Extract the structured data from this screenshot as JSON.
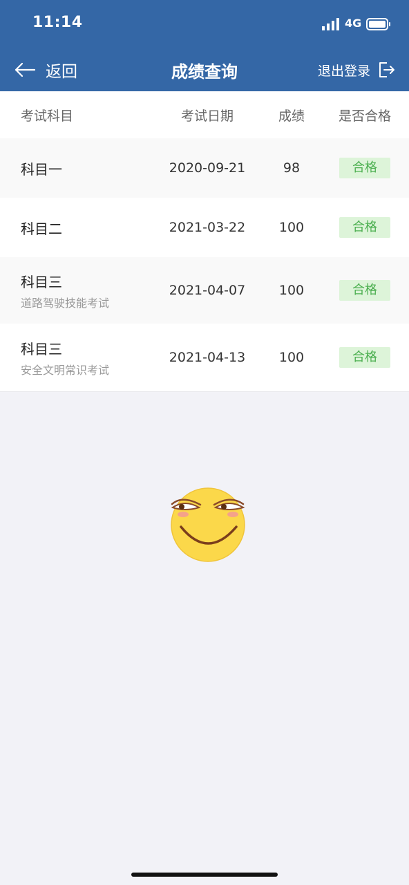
{
  "status_bar": {
    "time": "11:14",
    "network": "4G"
  },
  "nav": {
    "back_label": "返回",
    "title": "成绩查询",
    "logout_label": "退出登录"
  },
  "table": {
    "headers": {
      "subject": "考试科目",
      "date": "考试日期",
      "score": "成绩",
      "pass": "是否合格"
    },
    "rows": [
      {
        "subject": "科目一",
        "subtitle": "",
        "date": "2020-09-21",
        "score": "98",
        "status": "合格"
      },
      {
        "subject": "科目二",
        "subtitle": "",
        "date": "2021-03-22",
        "score": "100",
        "status": "合格"
      },
      {
        "subject": "科目三",
        "subtitle": "道路驾驶技能考试",
        "date": "2021-04-07",
        "score": "100",
        "status": "合格"
      },
      {
        "subject": "科目三",
        "subtitle": "安全文明常识考试",
        "date": "2021-04-13",
        "score": "100",
        "status": "合格"
      }
    ]
  },
  "colors": {
    "header_bg": "#3467a6",
    "pass_badge_bg": "#ddf4d9",
    "pass_badge_text": "#4caf50"
  },
  "icons": {
    "back": "arrow-left-icon",
    "logout": "logout-icon",
    "decoration": "smirk-emoji-icon"
  }
}
